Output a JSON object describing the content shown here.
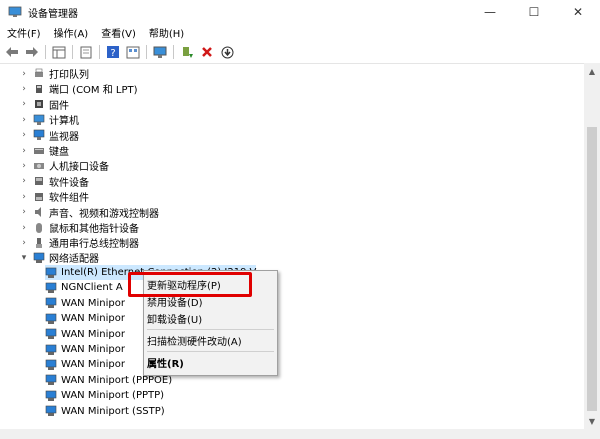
{
  "window": {
    "title": "设备管理器",
    "minimize_glyph": "—",
    "maximize_glyph": "☐",
    "close_glyph": "✕"
  },
  "menu": [
    "文件(F)",
    "操作(A)",
    "查看(V)",
    "帮助(H)"
  ],
  "toolbar_icons": [
    "back-arrow-icon",
    "forward-arrow-icon",
    "properties-pane-icon",
    "print-icon",
    "help-icon",
    "view-icon",
    "monitor-icon",
    "update-driver-icon",
    "uninstall-icon",
    "download-icon"
  ],
  "tree": {
    "categories": [
      {
        "label": "打印队列",
        "icon": "printer-icon"
      },
      {
        "label": "端口 (COM 和 LPT)",
        "icon": "port-icon"
      },
      {
        "label": "固件",
        "icon": "firmware-icon"
      },
      {
        "label": "计算机",
        "icon": "computer-icon"
      },
      {
        "label": "监视器",
        "icon": "monitor-icon"
      },
      {
        "label": "键盘",
        "icon": "keyboard-icon"
      },
      {
        "label": "人机接口设备",
        "icon": "hid-icon"
      },
      {
        "label": "软件设备",
        "icon": "software-device-icon"
      },
      {
        "label": "软件组件",
        "icon": "software-component-icon"
      },
      {
        "label": "声音、视频和游戏控制器",
        "icon": "sound-icon"
      },
      {
        "label": "鼠标和其他指针设备",
        "icon": "mouse-icon"
      },
      {
        "label": "通用串行总线控制器",
        "icon": "usb-icon"
      }
    ],
    "expanded": {
      "label": "网络适配器",
      "icon": "network-adapter-icon"
    },
    "adapters": [
      "Intel(R) Ethernet Connection (2) I219-V",
      "NGNClient A",
      "WAN Minipor",
      "WAN Minipor",
      "WAN Minipor",
      "WAN Minipor",
      "WAN Minipor",
      "WAN Miniport (PPPOE)",
      "WAN Miniport (PPTP)",
      "WAN Miniport (SSTP)"
    ]
  },
  "context_menu": {
    "update_driver": "更新驱动程序(P)",
    "disable": "禁用设备(D)",
    "uninstall": "卸载设备(U)",
    "scan": "扫描检测硬件改动(A)",
    "properties": "属性(R)"
  },
  "colors": {
    "highlight": "#e00000",
    "network": "#2a7fd4"
  }
}
